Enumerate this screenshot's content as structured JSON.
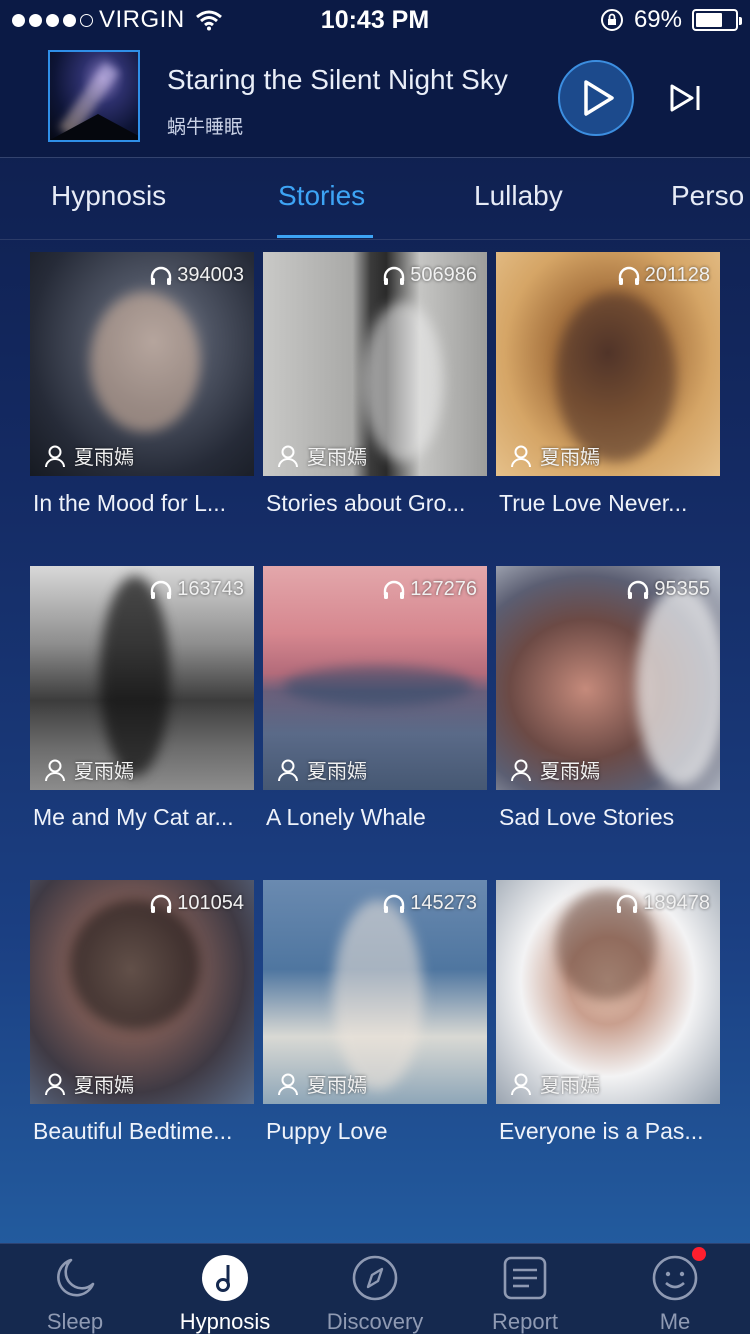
{
  "status_bar": {
    "carrier": "VIRGIN",
    "time": "10:43 PM",
    "battery": "69%",
    "battery_level": 0.69,
    "signal_bars": 4,
    "icons": [
      "wifi-icon",
      "orientation-lock-icon",
      "battery-icon"
    ]
  },
  "now_playing": {
    "title": "Staring the Silent Night Sky",
    "artist": "蜗牛睡眠",
    "icons": [
      "play-icon",
      "next-track-icon"
    ]
  },
  "tabs": [
    {
      "label": "Hypnosis"
    },
    {
      "label": "Stories"
    },
    {
      "label": "Lullaby"
    },
    {
      "label": "Perso"
    }
  ],
  "active_tab": "Stories",
  "cards": [
    {
      "title": "In the Mood for L...",
      "plays": "394003",
      "author": "夏雨嫣"
    },
    {
      "title": "Stories about Gro...",
      "plays": "506986",
      "author": "夏雨嫣"
    },
    {
      "title": "True Love Never...",
      "plays": "201128",
      "author": "夏雨嫣"
    },
    {
      "title": "Me and My Cat ar...",
      "plays": "163743",
      "author": "夏雨嫣"
    },
    {
      "title": "A Lonely Whale",
      "plays": "127276",
      "author": "夏雨嫣"
    },
    {
      "title": "Sad Love Stories",
      "plays": "95355",
      "author": "夏雨嫣"
    },
    {
      "title": "Beautiful Bedtime...",
      "plays": "101054",
      "author": "夏雨嫣"
    },
    {
      "title": "Puppy Love",
      "plays": "145273",
      "author": "夏雨嫣"
    },
    {
      "title": "Everyone is a Pas...",
      "plays": "189478",
      "author": "夏雨嫣"
    }
  ],
  "tabbar": [
    {
      "label": "Sleep",
      "icon": "moon-icon"
    },
    {
      "label": "Hypnosis",
      "icon": "music-note-icon"
    },
    {
      "label": "Discovery",
      "icon": "compass-icon"
    },
    {
      "label": "Report",
      "icon": "report-icon"
    },
    {
      "label": "Me",
      "icon": "smiley-icon",
      "has_badge": true
    }
  ],
  "active_tabbar": "Hypnosis",
  "colors": {
    "accent": "#3da4f5",
    "background_top": "#0d1c48",
    "background_bottom": "#2563a6",
    "badge": "#ff1f2e"
  }
}
